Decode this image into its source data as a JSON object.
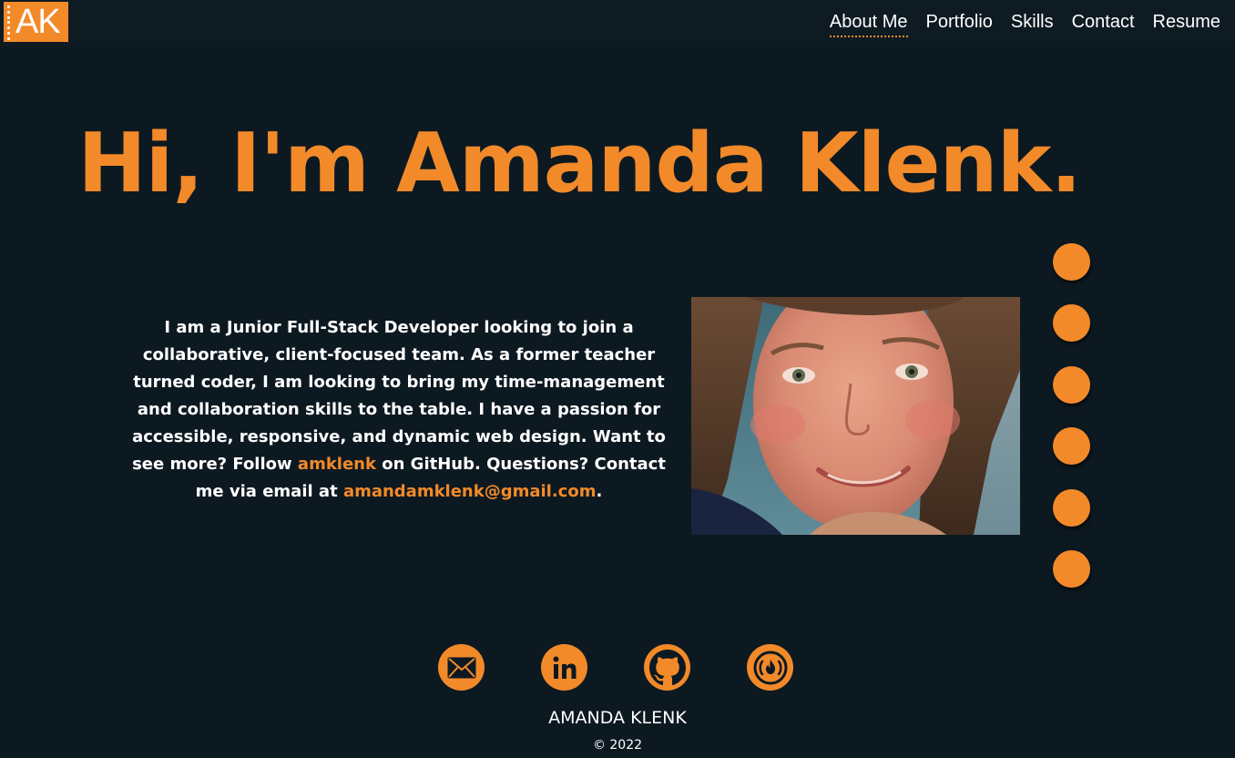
{
  "header": {
    "logo_text": "AK",
    "nav": [
      {
        "label": "About Me",
        "active": true
      },
      {
        "label": "Portfolio",
        "active": false
      },
      {
        "label": "Skills",
        "active": false
      },
      {
        "label": "Contact",
        "active": false
      },
      {
        "label": "Resume",
        "active": false
      }
    ]
  },
  "hero": {
    "title": "Hi, I'm Amanda Klenk."
  },
  "bio": {
    "text_1": "I am a Junior Full-Stack Developer looking to join a collaborative, client-focused team. As a former teacher turned coder, I am looking to bring my time-management and collaboration skills to the table. I have a passion for accessible, responsive, and dynamic web design. Want to see more? Follow ",
    "github_link": "amklenk",
    "text_2": " on GitHub. Questions? Contact me via email at ",
    "email_link": "amandamklenk@gmail.com",
    "text_3": "."
  },
  "photo": {
    "icon": "profile-photo"
  },
  "section_dots": {
    "count": 6,
    "icon": "section-nav-dot"
  },
  "footer": {
    "socials": [
      {
        "name": "email-icon"
      },
      {
        "name": "linkedin-icon"
      },
      {
        "name": "github-icon"
      },
      {
        "name": "freecodecamp-icon"
      }
    ],
    "name": "AMANDA KLENK",
    "copyright": "© 2022"
  },
  "colors": {
    "background": "#0d1921",
    "header": "#0f1b23",
    "accent": "#f28a2a",
    "text": "#ffffff"
  }
}
